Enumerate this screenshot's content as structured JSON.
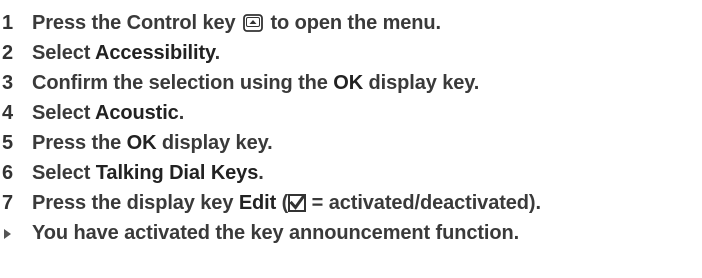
{
  "heading_fragment": "...",
  "steps": [
    {
      "num": "1",
      "pre": "Press the Control key",
      "post": "to open the menu.",
      "icon": "control-key-icon"
    },
    {
      "num": "2",
      "pre": "Select ",
      "bold": "Accessibility",
      "post": "."
    },
    {
      "num": "3",
      "pre": "Confirm the selection using the ",
      "bold": "OK",
      "post": " display key."
    },
    {
      "num": "4",
      "pre": "Select ",
      "bold": "Acoustic",
      "post": "."
    },
    {
      "num": "5",
      "pre": "Press the ",
      "bold": "OK",
      "post": " display key."
    },
    {
      "num": "6",
      "pre": "Select ",
      "bold": "Talking Dial Keys",
      "post": "."
    },
    {
      "num": "7",
      "pre": "Press the display key ",
      "bold": "Edit",
      "open": " (",
      "icon": "checkbox-checked-icon",
      "post": " = activated/deactivated)."
    }
  ],
  "result": {
    "marker_icon": "triangle-right-icon",
    "text": "You have activated the key announcement function."
  }
}
